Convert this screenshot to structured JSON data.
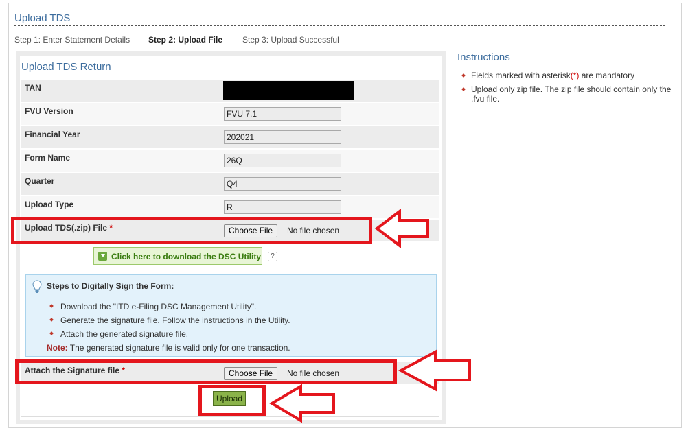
{
  "header": {
    "title": "Upload TDS",
    "steps": [
      {
        "label": "Step 1: Enter Statement Details",
        "active": false
      },
      {
        "label": "Step 2: Upload File",
        "active": true
      },
      {
        "label": "Step 3: Upload Successful",
        "active": false
      }
    ]
  },
  "form": {
    "legend": "Upload TDS Return",
    "rows": {
      "tan": {
        "label": "TAN"
      },
      "fvu_version": {
        "label": "FVU Version",
        "value": "FVU 7.1"
      },
      "financial_year": {
        "label": "Financial Year",
        "value": "202021"
      },
      "form_name": {
        "label": "Form Name",
        "value": "26Q"
      },
      "quarter": {
        "label": "Quarter",
        "value": "Q4"
      },
      "upload_type": {
        "label": "Upload Type",
        "value": "R"
      },
      "upload_file": {
        "label": "Upload TDS(.zip) File",
        "required_mark": "*",
        "button": "Choose File",
        "status": "No file chosen"
      },
      "signature": {
        "label": "Attach the Signature file",
        "required_mark": "*",
        "button": "Choose File",
        "status": "No file chosen"
      }
    },
    "dsc_link": "Click here to download the DSC Utility",
    "help_icon": "?",
    "sign_steps": {
      "heading": "Steps to Digitally Sign the Form:",
      "items": [
        "Download the \"ITD e-Filing DSC Management Utility\".",
        "Generate the signature file. Follow the instructions in the Utility.",
        "Attach the generated signature file."
      ],
      "note_label": "Note:",
      "note_text": " The generated signature file is valid only for one transaction."
    },
    "upload_button": "Upload"
  },
  "instructions": {
    "title": "Instructions",
    "item1_before": "Fields marked with asterisk",
    "item1_star": "(*)",
    "item1_after": " are mandatory",
    "item2": "Upload only zip file. The zip file should contain only the .fvu file."
  },
  "colors": {
    "accent": "#3d6d9e",
    "highlight": "#e4161d",
    "upload_button": "#8ab34a",
    "info_box": "#e3f2fb"
  },
  "icons": [
    "download-icon",
    "help-icon",
    "lightbulb-icon",
    "arrow-left-icon"
  ]
}
